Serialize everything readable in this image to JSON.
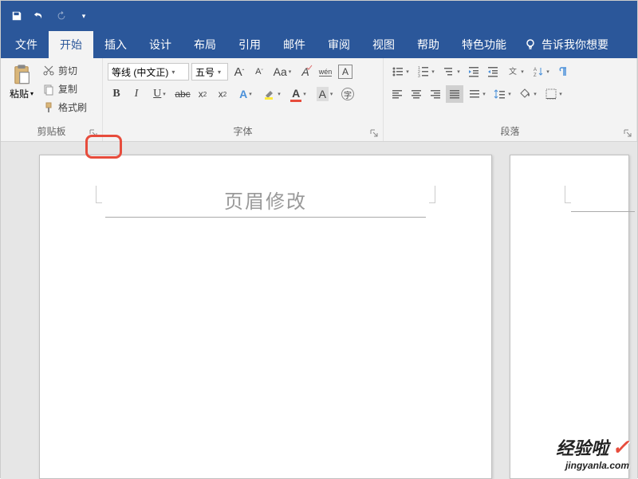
{
  "qat": {
    "save": "保存",
    "undo": "撤销",
    "redo": "恢复"
  },
  "tabs": {
    "file": "文件",
    "home": "开始",
    "insert": "插入",
    "design": "设计",
    "layout": "布局",
    "references": "引用",
    "mailings": "邮件",
    "review": "审阅",
    "view": "视图",
    "help": "帮助",
    "special": "特色功能"
  },
  "tell_me": "告诉我你想要",
  "clipboard": {
    "paste": "粘贴",
    "cut": "剪切",
    "copy": "复制",
    "format_painter": "格式刷",
    "group": "剪贴板"
  },
  "font": {
    "name": "等线 (中文正)",
    "size": "五号",
    "group": "字体",
    "bold": "B",
    "italic": "I",
    "underline": "U",
    "grow": "A",
    "shrink": "A",
    "change_case": "Aa",
    "clear_format": "A",
    "phonetic": "wén",
    "char_border": "A"
  },
  "paragraph": {
    "group": "段落"
  },
  "document": {
    "header_text": "页眉修改"
  },
  "watermark": {
    "main": "经验啦",
    "sub": "jingyanla.com"
  }
}
